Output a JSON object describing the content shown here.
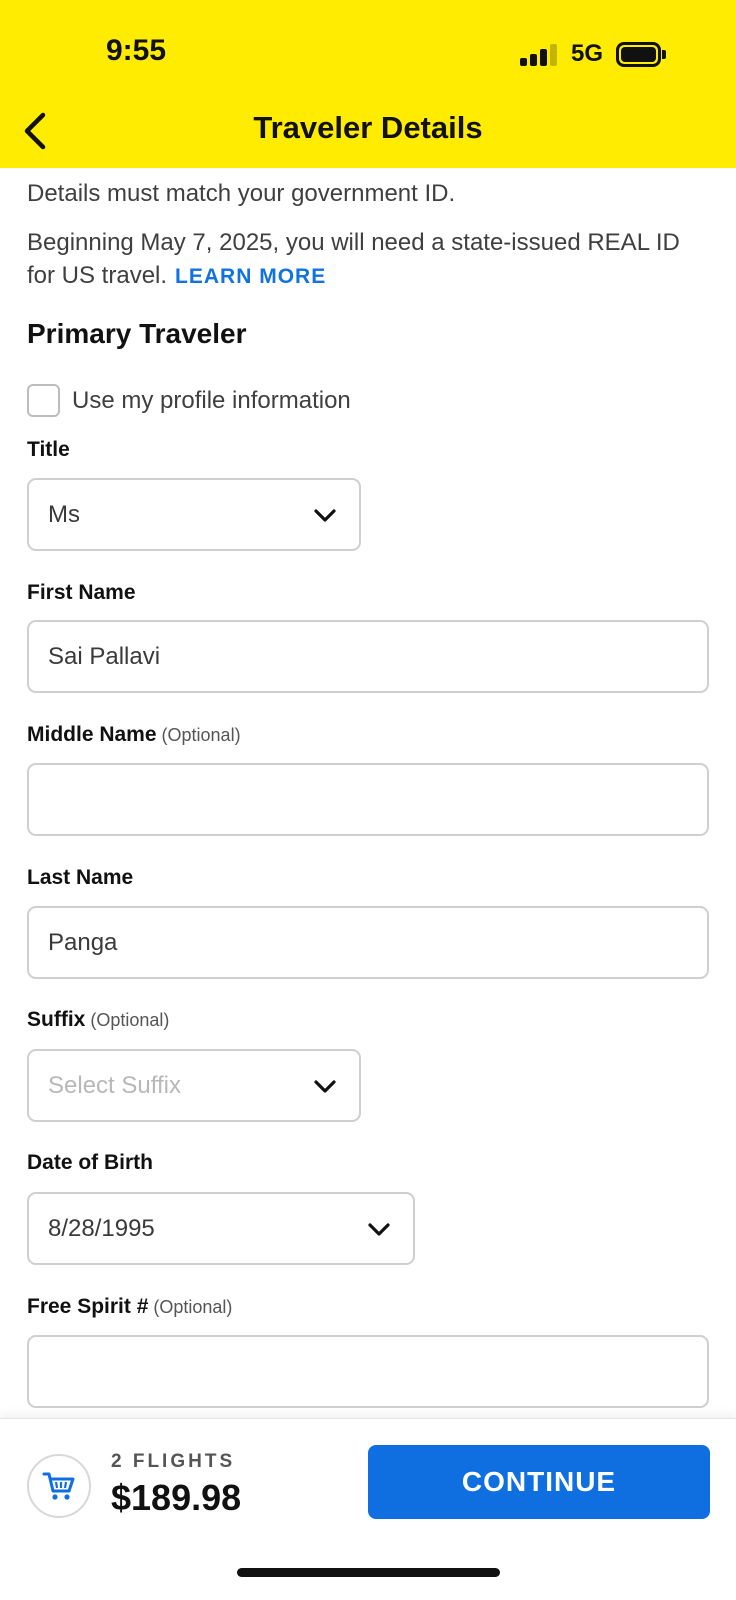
{
  "status_bar": {
    "time": "9:55",
    "network": "5G",
    "signal_bars": 3,
    "battery_level": 1
  },
  "header": {
    "title": "Traveler Details",
    "back_icon": "chevron-left-icon",
    "background": "#ffec00"
  },
  "intro": {
    "line1": "Details must match your government ID.",
    "line2": "Beginning May 7, 2025, you will need a state-issued REAL ID for US travel.",
    "learn_more": "LEARN MORE"
  },
  "section_title": "Primary Traveler",
  "profile_checkbox": {
    "label": "Use my profile information",
    "checked": false
  },
  "optional_label": "(Optional)",
  "fields": {
    "title": {
      "label": "Title",
      "value": "Ms"
    },
    "first_name": {
      "label": "First Name",
      "value": "Sai Pallavi"
    },
    "middle_name": {
      "label": "Middle Name",
      "value": ""
    },
    "last_name": {
      "label": "Last Name",
      "value": "Panga"
    },
    "suffix": {
      "label": "Suffix",
      "placeholder": "Select Suffix"
    },
    "dob": {
      "label": "Date of Birth",
      "value": "8/28/1995"
    },
    "free_spirit": {
      "label": "Free Spirit #",
      "value": ""
    }
  },
  "footer": {
    "flights_count": "2 FLIGHTS",
    "total": "$189.98",
    "continue_label": "CONTINUE",
    "cart_icon": "cart-icon",
    "accent": "#0f6fe1"
  }
}
